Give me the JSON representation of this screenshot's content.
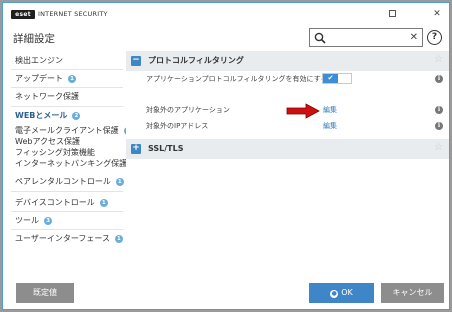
{
  "window": {
    "logo": "eset",
    "product": "INTERNET SECURITY",
    "minimize": "☐",
    "close": "✕"
  },
  "header": {
    "title": "詳細設定",
    "search_value": "",
    "search_clear": "✕",
    "help": "?"
  },
  "sidebar": {
    "items": [
      {
        "label": "検出エンジン"
      },
      {
        "label": "アップデート",
        "badge": "1"
      },
      {
        "label": "ネットワーク保護"
      },
      {
        "label": "WEBとメール",
        "badge": "2"
      },
      {
        "label": "電子メールクライアント保護",
        "badge": "1"
      },
      {
        "label": "Webアクセス保護"
      },
      {
        "label": "フィッシング対策機能"
      },
      {
        "label": "インターネットバンキング保護",
        "badge": "1"
      },
      {
        "label": "ペアレンタルコントロール",
        "badge": "1"
      },
      {
        "label": "デバイスコントロール",
        "badge": "1"
      },
      {
        "label": "ツール",
        "badge": "3"
      },
      {
        "label": "ユーザーインターフェース",
        "badge": "1"
      }
    ]
  },
  "main": {
    "section1": {
      "title": "プロトコルフィルタリング",
      "expander": "−",
      "settings": [
        {
          "label": "アプリケーションプロトコルフィルタリングを有効にする",
          "toggle": "✔",
          "enabled": true
        },
        {
          "label": "対象外のアプリケーション",
          "link": "編集"
        },
        {
          "label": "対象外のIPアドレス",
          "link": "編集"
        }
      ]
    },
    "section2": {
      "title": "SSL/TLS",
      "expander": "+"
    },
    "info": "i",
    "star": "☆"
  },
  "footer": {
    "default_label": "既定値",
    "ok_label": "OK",
    "ok_icon": "●",
    "cancel_label": "キャンセル"
  },
  "colors": {
    "accent": "#3f86c8",
    "badge": "#6aaed8",
    "section_bg": "#e9ecef",
    "arrow": "#d01010"
  }
}
